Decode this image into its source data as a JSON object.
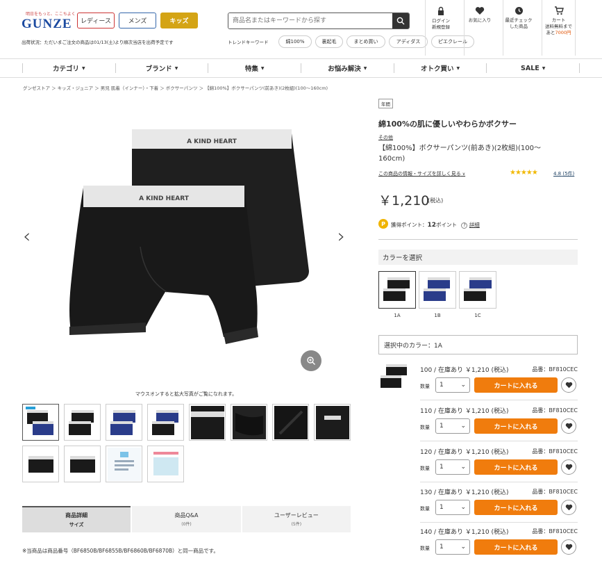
{
  "header": {
    "tagline": "明日をもっと、ここちよく",
    "logo": "GUNZE",
    "genders": [
      "レディース",
      "メンズ",
      "キッズ"
    ],
    "search_placeholder": "商品名またはキーワードから探す",
    "shipping_status": "出荷状況：ただいまご注文の商品は01/13(土)より順次当店を出荷予定です",
    "trend_label": "トレンドキーワード",
    "trend_keywords": [
      "綿100%",
      "裏起毛",
      "まとめ買い",
      "アディダス",
      "ピエクレール"
    ],
    "icons": [
      {
        "icon": "login-icon",
        "label1": "ログイン",
        "label2": "新規登録"
      },
      {
        "icon": "heart-icon",
        "label1": "お気に入り",
        "label2": ""
      },
      {
        "icon": "clock-icon",
        "label1": "最近チェック",
        "label2": "した商品"
      },
      {
        "icon": "cart-icon",
        "label1": "カート",
        "label2": "送料無料まで",
        "label3": "あと",
        "label4": "7000円"
      }
    ]
  },
  "nav": [
    "カテゴリ",
    "ブランド",
    "特集",
    "お悩み解決",
    "オトク買い",
    "SALE"
  ],
  "breadcrumb": "グンゼストア ＞ キッズ・ジュニア ＞ 男児 肌着（インナー）・下着 ＞ ボクサーパンツ ＞ 【綿100%】ボクサーパンツ(前あき)(2枚組)(100～160cm)",
  "product": {
    "hover_text": "マウスオンすると拡大写真がご覧になれます。",
    "waistband_text": "A KIND HEART",
    "badge": "年間",
    "catch": "綿100%の肌に優しいやわらかボクサー",
    "brand": "その他",
    "name": "【綿100%】ボクサーパンツ(前あき)(2枚組)(100～160cm)",
    "detail_link": "この商品の情報・サイズを詳しく見る",
    "stars": "★★★★★",
    "rating": "4.8",
    "reviews": "(5件)",
    "price": "￥1,210",
    "tax": "(税込)",
    "point_icon": "P",
    "points": "獲得ポイント：",
    "points_value": "12",
    "points_unit": "ポイント",
    "points_link": "詳細",
    "color_heading": "カラーを選択",
    "colors": [
      "1A",
      "1B",
      "1C"
    ],
    "selected_color": "選択中のカラー：1A"
  },
  "sizes": [
    {
      "size": "100",
      "stock": "在庫あり",
      "price": "￥1,210 (税込)",
      "code": "品番：BF810CEC",
      "qty": "1"
    },
    {
      "size": "110",
      "stock": "在庫あり",
      "price": "￥1,210 (税込)",
      "code": "品番：BF810CEC",
      "qty": "1"
    },
    {
      "size": "120",
      "stock": "在庫あり",
      "price": "￥1,210 (税込)",
      "code": "品番：BF810CEC",
      "qty": "1"
    },
    {
      "size": "130",
      "stock": "在庫あり",
      "price": "￥1,210 (税込)",
      "code": "品番：BF810CEC",
      "qty": "1"
    },
    {
      "size": "140",
      "stock": "在庫あり",
      "price": "￥1,210 (税込)",
      "code": "品番：BF810CEC",
      "qty": "1"
    }
  ],
  "row_labels": {
    "qty": "数量",
    "cart": "カートに入れる",
    "sep": " / "
  },
  "tabs": [
    {
      "label": "商品詳細",
      "sub": "サイズ"
    },
    {
      "label": "商品Q&A",
      "sub": "(0件)"
    },
    {
      "label": "ユーザーレビュー",
      "sub": "(5件)"
    }
  ],
  "note": "※当商品は商品番号（BF6850B/BF6855B/BF6860B/BF6870B）と同一商品です。"
}
